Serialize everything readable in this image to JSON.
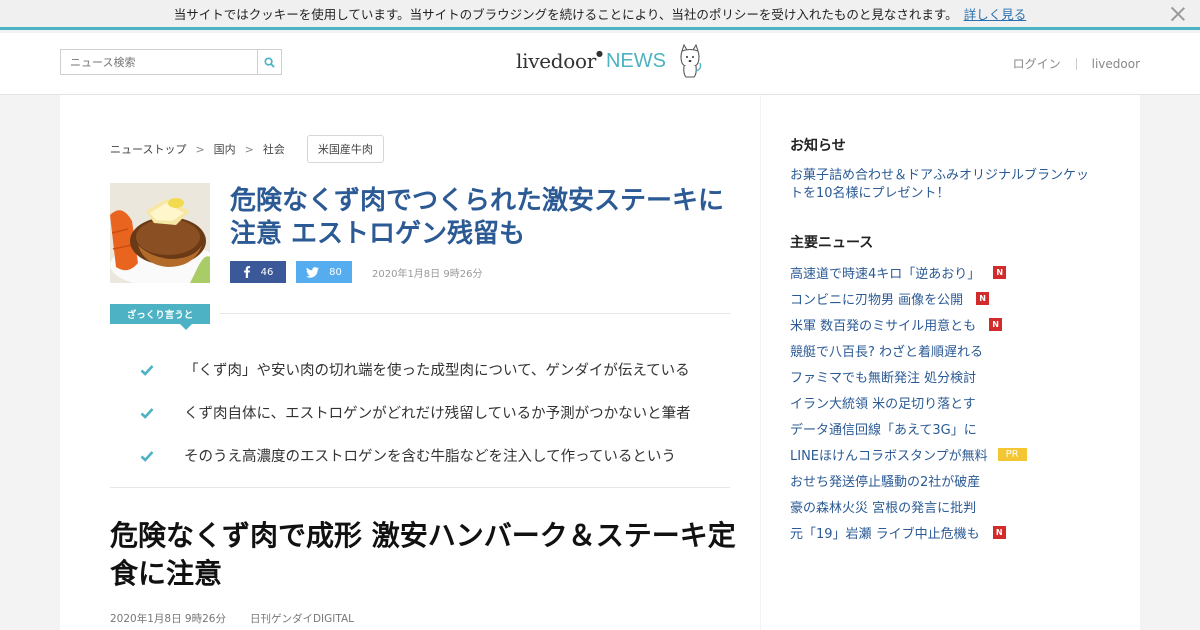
{
  "cookie": {
    "message": "当サイトではクッキーを使用しています。当サイトのブラウジングを続けることにより、当社のポリシーを受け入れたものと見なされます。",
    "more_link": "詳しく見る"
  },
  "header": {
    "search_placeholder": "ニュース検索",
    "logo_livedoor": "livedoor",
    "logo_news": "NEWS",
    "login": "ログイン",
    "livedoor_link": "livedoor"
  },
  "breadcrumb": {
    "items": [
      "ニューストップ",
      "国内",
      "社会"
    ],
    "tag": "米国産牛肉"
  },
  "article": {
    "headline": "危険なくず肉でつくられた激安ステーキに注意 エストロゲン残留も",
    "facebook_count": "46",
    "twitter_count": "80",
    "date": "2020年1月8日 9時26分",
    "summary_label": "ざっくり言うと",
    "points": [
      "「くず肉」や安い肉の切れ端を使った成型肉について、ゲンダイが伝えている",
      "くず肉自体に、エストロゲンがどれだけ残留しているか予測がつかないと筆者",
      "そのうえ高濃度のエストロゲンを含む牛脂などを注入して作っているという"
    ],
    "full_title": "危険なくず肉で成形 激安ハンバーク＆ステーキ定食に注意",
    "full_date": "2020年1月8日 9時26分",
    "source": "日刊ゲンダイDIGITAL"
  },
  "sidebar": {
    "notice_heading": "お知らせ",
    "notice_text": "お菓子詰め合わせ＆ドアふみオリジナルブランケットを10名様にプレゼント！",
    "news_heading": "主要ニュース",
    "news": [
      {
        "text": "高速道で時速4キロ「逆あおり」",
        "badge": "N"
      },
      {
        "text": "コンビニに刃物男 画像を公開",
        "badge": "N"
      },
      {
        "text": "米軍 数百発のミサイル用意とも",
        "badge": "N"
      },
      {
        "text": "競艇で八百長? わざと着順遅れる",
        "badge": ""
      },
      {
        "text": "ファミマでも無断発注 処分検討",
        "badge": ""
      },
      {
        "text": "イラン大統領 米の足切り落とす",
        "badge": ""
      },
      {
        "text": "データ通信回線「あえて3G」に",
        "badge": ""
      },
      {
        "text": "LINEほけんコラボスタンプが無料",
        "badge": "PR"
      },
      {
        "text": "おせち発送停止騒動の2社が破産",
        "badge": ""
      },
      {
        "text": "豪の森林火災 宮根の発言に批判",
        "badge": ""
      },
      {
        "text": "元「19」岩瀬 ライブ中止危機も",
        "badge": "N"
      }
    ]
  },
  "colors": {
    "accent": "#4db2c4",
    "link": "#2b5a94",
    "facebook": "#3b5998",
    "twitter": "#55acee",
    "new_badge": "#d12b2b",
    "pr_badge": "#f4c634"
  }
}
